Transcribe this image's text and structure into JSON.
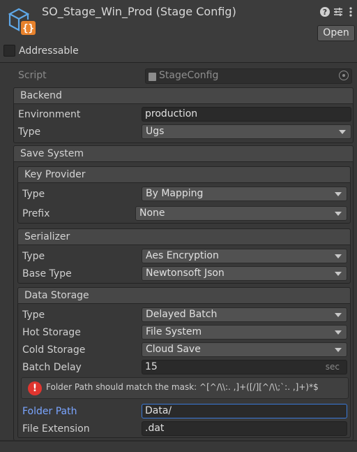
{
  "header": {
    "title": "SO_Stage_Win_Prod (Stage Config)",
    "open_label": "Open",
    "addressable_label": "Addressable",
    "addressable_checked": false,
    "icons": [
      "scriptable-object-icon",
      "help-icon",
      "presets-icon",
      "more-icon"
    ]
  },
  "script": {
    "label": "Script",
    "value": "StageConfig"
  },
  "backend": {
    "header": "Backend",
    "environment_label": "Environment",
    "environment_value": "production",
    "type_label": "Type",
    "type_value": "Ugs"
  },
  "save_system": {
    "header": "Save System",
    "key_provider": {
      "header": "Key Provider",
      "type_label": "Type",
      "type_value": "By Mapping",
      "prefix_label": "Prefix",
      "prefix_value": "None"
    },
    "serializer": {
      "header": "Serializer",
      "type_label": "Type",
      "type_value": "Aes Encryption",
      "base_type_label": "Base Type",
      "base_type_value": "Newtonsoft Json"
    },
    "data_storage": {
      "header": "Data Storage",
      "type_label": "Type",
      "type_value": "Delayed Batch",
      "hot_label": "Hot Storage",
      "hot_value": "File System",
      "cold_label": "Cold Storage",
      "cold_value": "Cloud Save",
      "batch_label": "Batch Delay",
      "batch_value": "15",
      "batch_unit": "sec",
      "error_text": "Folder Path should match the mask: ^[^/\\\\:. ,]+([/][^/\\\\;`:. ,]+)*$",
      "folder_label": "Folder Path",
      "folder_value": "Data/",
      "ext_label": "File Extension",
      "ext_value": ".dat"
    }
  },
  "colors": {
    "background": "#383838",
    "focus_blue": "#7aa5ff",
    "error_red": "#e0352f",
    "logo_blue": "#5fa8e8",
    "logo_orange": "#e8822c"
  }
}
